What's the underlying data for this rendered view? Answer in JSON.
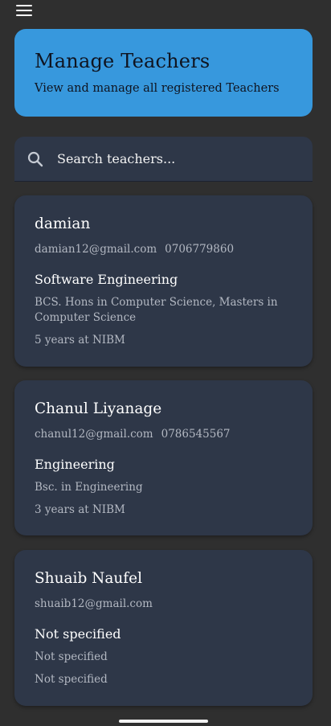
{
  "header": {
    "title": "Manage Teachers",
    "subtitle": "View and manage all registered Teachers"
  },
  "search": {
    "placeholder": "Search teachers..."
  },
  "teachers": [
    {
      "name": "damian",
      "email": "damian12@gmail.com",
      "phone": "0706779860",
      "department": "Software Engineering",
      "qualification": "BCS. Hons in Computer Science, Masters in Computer Science",
      "experience": "5 years at NIBM"
    },
    {
      "name": "Chanul Liyanage",
      "email": "chanul12@gmail.com",
      "phone": "0786545567",
      "department": "Engineering",
      "qualification": "Bsc. in Engineering",
      "experience": "3 years at NIBM"
    },
    {
      "name": "Shuaib Naufel",
      "email": "shuaib12@gmail.com",
      "phone": "",
      "department": "Not specified",
      "qualification": "Not specified",
      "experience": "Not specified"
    }
  ],
  "colors": {
    "background": "#2f2f2f",
    "header": "#3798dd",
    "card": "#2e3748",
    "muted_text": "#b3b8c2"
  },
  "icons": {
    "menu": "menu-icon",
    "search": "search-icon"
  }
}
